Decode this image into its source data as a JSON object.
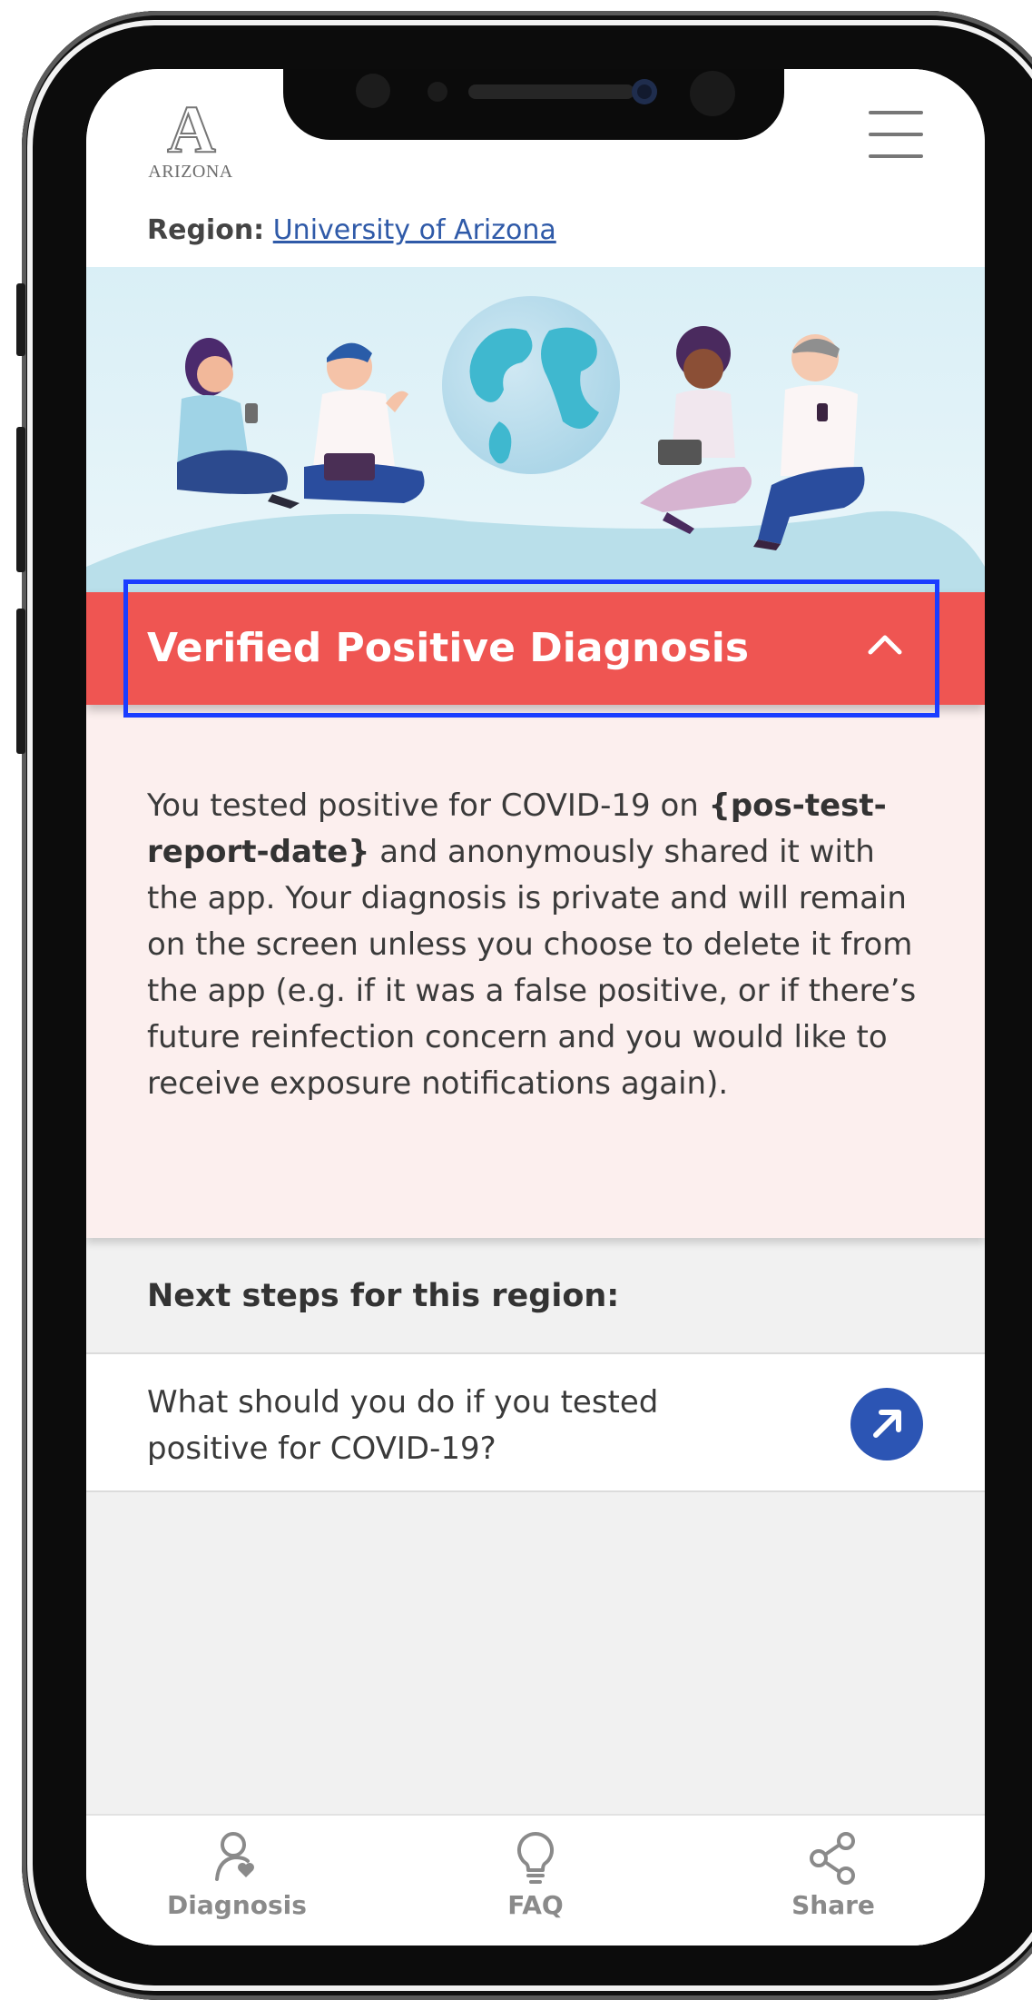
{
  "header": {
    "logo_text": "ARIZONA",
    "region_label": "Region:",
    "region_link": "University of Arizona"
  },
  "banner": {
    "title": "Verified Positive Diagnosis"
  },
  "diagnosis": {
    "text_before": "You tested positive for COVID-19 on ",
    "date_placeholder": "{pos-test-report-date}",
    "text_after": " and anonymously shared it with the app. Your diagnosis is private and will remain on the screen unless you choose to delete it from the app (e.g. if it was a false positive, or if there’s future reinfection concern and you would like to receive exposure notifications again)."
  },
  "next_steps": {
    "header": "Next steps for this region:",
    "items": [
      {
        "label": "What should you do if you tested positive for COVID-19?"
      }
    ]
  },
  "bottom_nav": {
    "items": [
      {
        "label": "Diagnosis",
        "icon": "person-heart-icon"
      },
      {
        "label": "FAQ",
        "icon": "lightbulb-icon"
      },
      {
        "label": "Share",
        "icon": "share-icon"
      }
    ]
  },
  "colors": {
    "banner": "#ef5552",
    "panel": "#fcefee",
    "link": "#2f5aa8",
    "action_button": "#2c55b4",
    "highlight": "#1a3dff"
  }
}
